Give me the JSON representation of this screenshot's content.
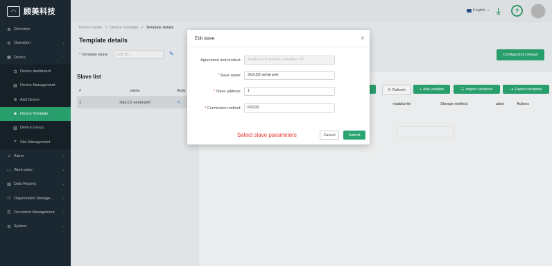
{
  "app": {
    "logo_text": "顾美科技"
  },
  "sidebar": {
    "items": [
      {
        "label": "Overview",
        "icon": "overview-icon",
        "glyph": "⊞",
        "chevron": ""
      },
      {
        "label": "Operation",
        "icon": "operation-icon",
        "glyph": "⚙",
        "chevron": "⌄"
      },
      {
        "label": "Device",
        "icon": "device-icon",
        "glyph": "▦",
        "chevron": "⌃"
      },
      {
        "label": "Device dashboard",
        "icon": "dashboard-icon",
        "glyph": "⊡",
        "chevron": ""
      },
      {
        "label": "Device Management",
        "icon": "device-management-icon",
        "glyph": "▤",
        "chevron": ""
      },
      {
        "label": "Add Device",
        "icon": "add-device-icon",
        "glyph": "⊕",
        "chevron": ""
      },
      {
        "label": "Device Template",
        "icon": "device-template-icon",
        "glyph": "◈",
        "chevron": ""
      },
      {
        "label": "Device Group",
        "icon": "device-group-icon",
        "glyph": "▥",
        "chevron": ""
      },
      {
        "label": "Site Management",
        "icon": "site-management-icon",
        "glyph": "⌖",
        "chevron": ""
      },
      {
        "label": "Alarm",
        "icon": "alarm-icon",
        "glyph": "♫",
        "chevron": "⌄"
      },
      {
        "label": "Work order",
        "icon": "work-order-icon",
        "glyph": "▭",
        "chevron": "⌄"
      },
      {
        "label": "Data Reports",
        "icon": "data-reports-icon",
        "glyph": "▨",
        "chevron": "⌄"
      },
      {
        "label": "Organization Manage...",
        "icon": "organization-icon",
        "glyph": "⚇",
        "chevron": "⌄"
      },
      {
        "label": "Document Management",
        "icon": "document-icon",
        "glyph": "⎘",
        "chevron": "⌄"
      },
      {
        "label": "System",
        "icon": "system-icon",
        "glyph": "⊟",
        "chevron": "⌄"
      }
    ]
  },
  "header": {
    "language": "English",
    "language_chevron": "⌄"
  },
  "breadcrumb": {
    "items": [
      "Device center",
      "Device Template",
      "Template details"
    ],
    "separator": ">"
  },
  "page": {
    "title": "Template details",
    "template_name_label": "Template name",
    "template_name_value": "DS0 Th...",
    "config_button": "Configuration design"
  },
  "slave_list": {
    "title": "Slave list",
    "columns": [
      "#",
      "name",
      "Actio"
    ],
    "rows": [
      {
        "index": "1",
        "name": "3G/LD2 serial port"
      }
    ]
  },
  "variables": {
    "refresh": "Refresh",
    "add_variable": "Add variable",
    "import_variables": "Import variables",
    "export_variables": "Export variables",
    "columns": [
      "read&write",
      "Storage method",
      "ation",
      "Actions"
    ]
  },
  "modal": {
    "title": "Edit slave",
    "fields": [
      {
        "label": "Agreement and product:",
        "required": false,
        "value": "ModbusRTU/Modbus/Modbus RT...",
        "disabled": true
      },
      {
        "label": "Slave name:",
        "required": true,
        "value": "3G/LD2 serial port",
        "disabled": false
      },
      {
        "label": "Slave address:",
        "required": true,
        "value": "1",
        "disabled": false
      },
      {
        "label": "Connection method:",
        "required": true,
        "value": "RS232",
        "disabled": false
      }
    ],
    "hint": "Select slave parameters",
    "cancel": "Cancel",
    "submit": "Submit"
  },
  "colors": {
    "accent": "#2ba471",
    "sidebar": "#1c2a33",
    "hint": "#e83434"
  }
}
